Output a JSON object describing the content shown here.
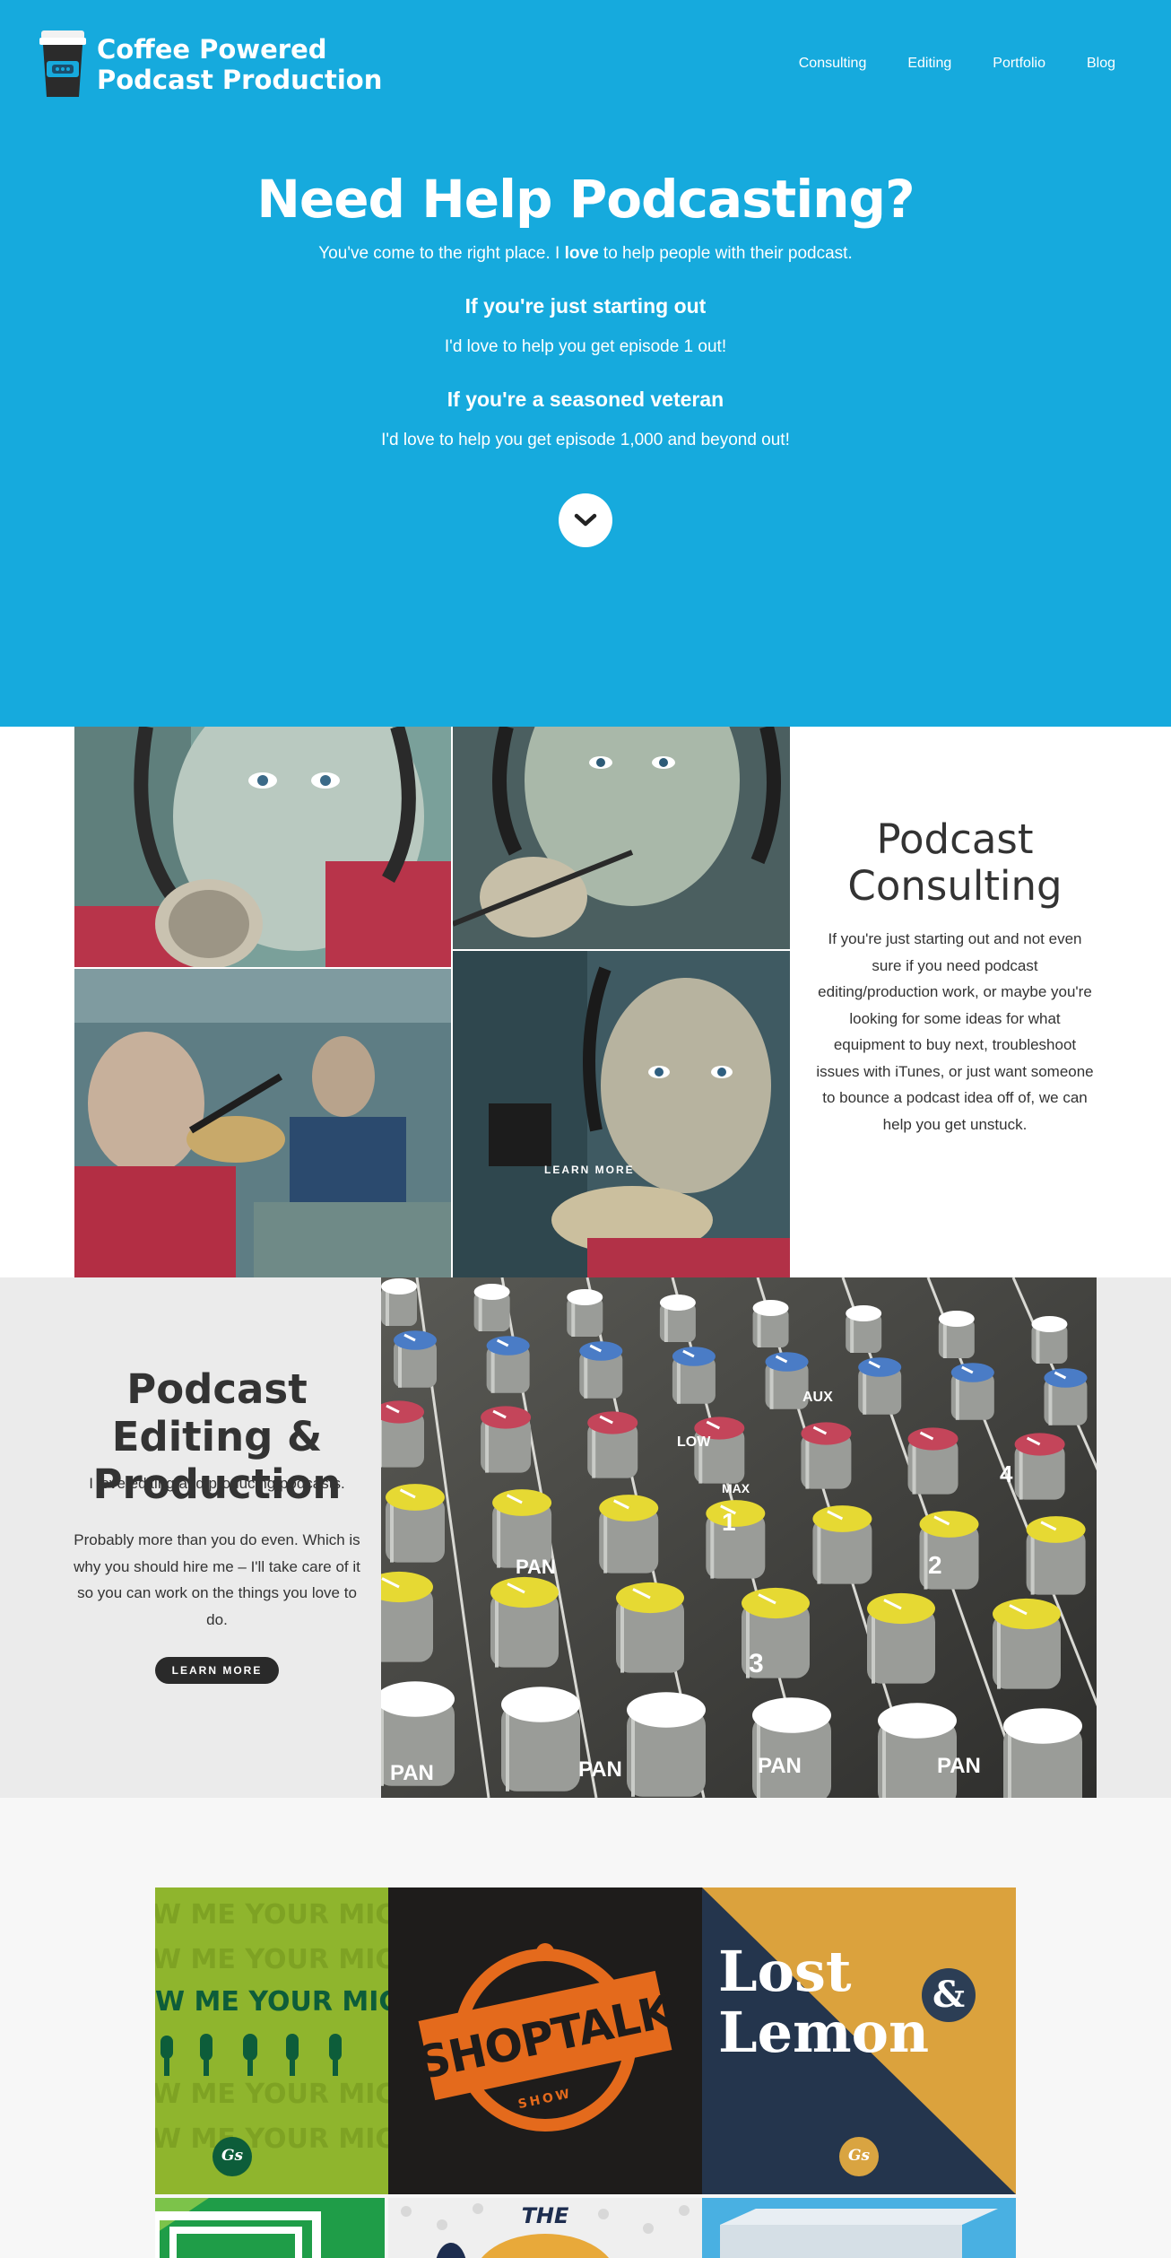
{
  "header": {
    "logo_line1": "Coffee Powered",
    "logo_line2": "Podcast Production",
    "nav": [
      "Consulting",
      "Editing",
      "Portfolio",
      "Blog"
    ]
  },
  "hero": {
    "title": "Need Help Podcasting?",
    "intro_before": "You've come to the right place. I ",
    "intro_bold": "love",
    "intro_after": " to help people with their podcast.",
    "beginner_heading": "If you're just starting out",
    "beginner_text": "I'd love to help you get episode 1 out!",
    "veteran_heading": "If you're a seasoned veteran",
    "veteran_text": "I'd love to help you get episode 1,000 and beyond out!"
  },
  "consulting": {
    "title": "Podcast Consulting",
    "text": "If you're just starting out and not even sure if you need podcast editing/production work, or maybe you're looking for some ideas for what equipment to buy next, troubleshoot issues with iTunes, or just want someone to bounce a podcast idea off of, we can help you get unstuck.",
    "overlay_label": "LEARN MORE"
  },
  "editing": {
    "title": "Podcast Editing & Production",
    "text1": "I love editing and producing podcasts.",
    "text2": "Probably more than you do even. Which is why you should hire me – I'll take care of it so you can work on the things you love to do.",
    "button": "LEARN MORE",
    "mixer_labels": [
      "AUX",
      "LOW",
      "MAX",
      "PAN",
      "1",
      "2",
      "3",
      "4"
    ]
  },
  "portfolio": {
    "tiles": [
      {
        "title": "W ME YOUR MIC",
        "badge": "Gs"
      },
      {
        "title": "SHOPTALK",
        "subtitle": "SHOW"
      },
      {
        "title_line1": "Lost",
        "amp": "&",
        "title_line2": "Lemon",
        "badge": "Gs"
      },
      {
        "title": "THE"
      }
    ]
  },
  "colors": {
    "hero_bg": "#16aadd",
    "editing_bg": "#ebebeb",
    "button_dark": "#2a2a2a"
  }
}
